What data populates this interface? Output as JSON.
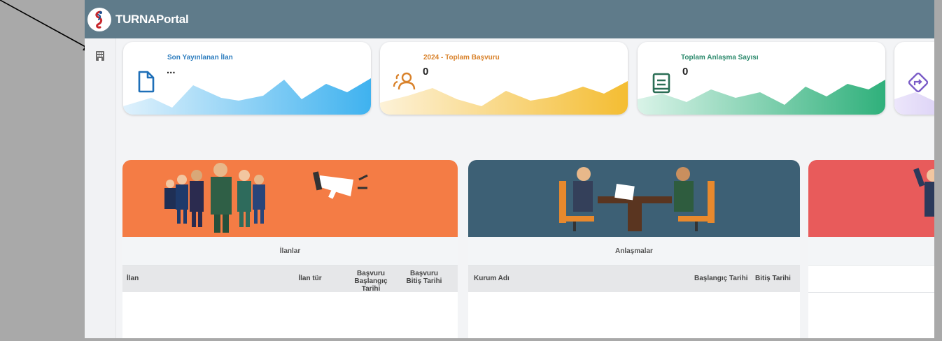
{
  "header": {
    "brand": "TURNAPortal"
  },
  "sidebar": {
    "icon": "building-icon"
  },
  "stats": [
    {
      "title": "Son Yayınlanan İlan",
      "value": "...",
      "icon": "document-icon",
      "accent": "#2f7ebf"
    },
    {
      "title": "2024 - Toplam Başvuru",
      "value": "0",
      "icon": "users-icon",
      "accent": "#d9822b"
    },
    {
      "title": "Toplam Anlaşma Sayısı",
      "value": "0",
      "icon": "book-icon",
      "accent": "#2e8b6e"
    },
    {
      "title": "",
      "value": "",
      "icon": "direction-sign-icon",
      "accent": "#7a5cc7"
    }
  ],
  "panels": {
    "ilanlar": {
      "title": "İlanlar",
      "banner_color": "#f47c45",
      "columns": [
        "İlan",
        "İlan tür",
        "Başvuru Başlangıç Tarihi",
        "Başvuru Bitiş Tarihi"
      ]
    },
    "anlasmalar": {
      "title": "Anlaşmalar",
      "banner_color": "#3d6075",
      "columns": [
        "Kurum Adı",
        "Başlangıç Tarihi",
        "Bitiş Tarihi"
      ]
    },
    "third": {
      "banner_color": "#e85b5b"
    }
  }
}
